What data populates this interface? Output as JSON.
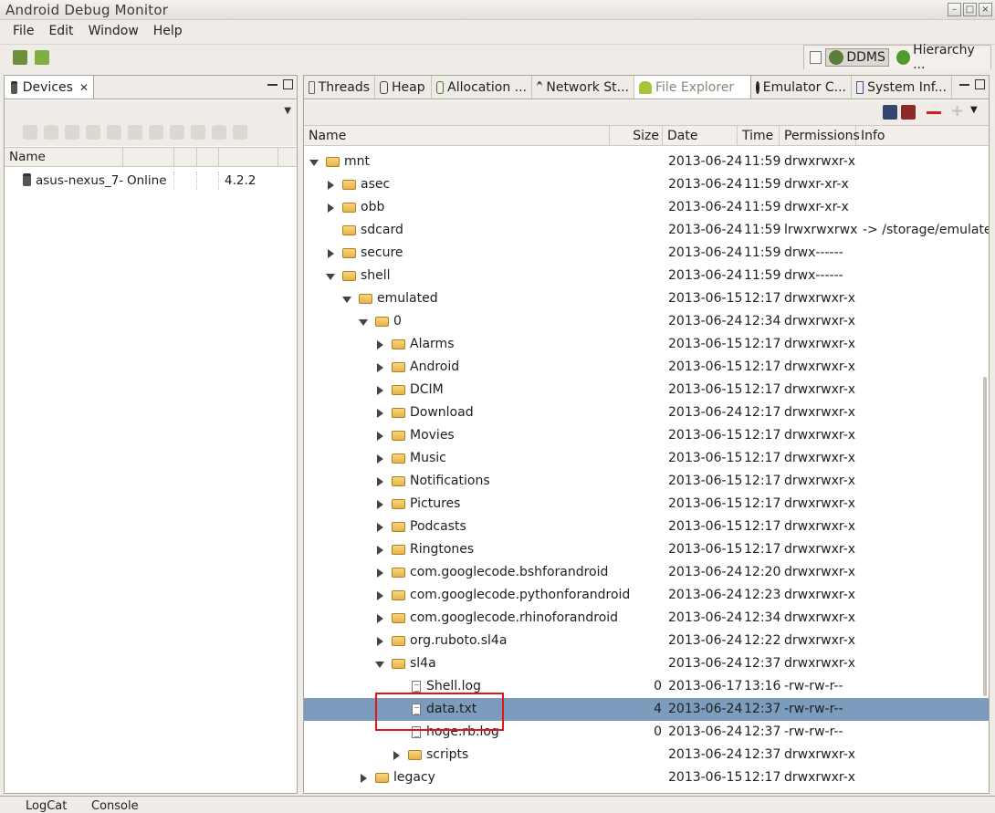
{
  "window": {
    "title": "Android Debug Monitor"
  },
  "menu": [
    "File",
    "Edit",
    "Window",
    "Help"
  ],
  "perspectives": [
    {
      "label": "DDMS",
      "active": true
    },
    {
      "label": "Hierarchy ...",
      "active": false
    }
  ],
  "devices_panel": {
    "tab_label": "Devices",
    "columns": [
      "Name",
      "",
      "",
      "",
      ""
    ],
    "rows": [
      {
        "name": "asus-nexus_7-",
        "status": "Online",
        "c3": "",
        "c4": "",
        "version": "4.2.2"
      }
    ]
  },
  "explorer_panel": {
    "tabs": [
      {
        "label": "Threads"
      },
      {
        "label": "Heap"
      },
      {
        "label": "Allocation ..."
      },
      {
        "label": "Network St..."
      },
      {
        "label": "File Explorer",
        "active": true
      },
      {
        "label": "Emulator C..."
      },
      {
        "label": "System Inf..."
      }
    ],
    "columns": {
      "name": "Name",
      "size": "Size",
      "date": "Date",
      "time": "Time",
      "permissions": "Permissions",
      "info": "Info"
    },
    "rows": [
      {
        "depth": 0,
        "toggle": "down",
        "kind": "folder",
        "name": "mnt",
        "size": "",
        "date": "2013-06-24",
        "time": "11:59",
        "perm": "drwxrwxr-x",
        "info": ""
      },
      {
        "depth": 1,
        "toggle": "right",
        "kind": "folder",
        "name": "asec",
        "size": "",
        "date": "2013-06-24",
        "time": "11:59",
        "perm": "drwxr-xr-x",
        "info": ""
      },
      {
        "depth": 1,
        "toggle": "right",
        "kind": "folder",
        "name": "obb",
        "size": "",
        "date": "2013-06-24",
        "time": "11:59",
        "perm": "drwxr-xr-x",
        "info": ""
      },
      {
        "depth": 1,
        "toggle": "none",
        "kind": "folder",
        "name": "sdcard",
        "size": "",
        "date": "2013-06-24",
        "time": "11:59",
        "perm": "lrwxrwxrwx",
        "info": "-> /storage/emulated/"
      },
      {
        "depth": 1,
        "toggle": "right",
        "kind": "folder",
        "name": "secure",
        "size": "",
        "date": "2013-06-24",
        "time": "11:59",
        "perm": "drwx------",
        "info": ""
      },
      {
        "depth": 1,
        "toggle": "down",
        "kind": "folder",
        "name": "shell",
        "size": "",
        "date": "2013-06-24",
        "time": "11:59",
        "perm": "drwx------",
        "info": ""
      },
      {
        "depth": 2,
        "toggle": "down",
        "kind": "folder",
        "name": "emulated",
        "size": "",
        "date": "2013-06-15",
        "time": "12:17",
        "perm": "drwxrwxr-x",
        "info": ""
      },
      {
        "depth": 3,
        "toggle": "down",
        "kind": "folder",
        "name": "0",
        "size": "",
        "date": "2013-06-24",
        "time": "12:34",
        "perm": "drwxrwxr-x",
        "info": ""
      },
      {
        "depth": 4,
        "toggle": "right",
        "kind": "folder",
        "name": "Alarms",
        "size": "",
        "date": "2013-06-15",
        "time": "12:17",
        "perm": "drwxrwxr-x",
        "info": ""
      },
      {
        "depth": 4,
        "toggle": "right",
        "kind": "folder",
        "name": "Android",
        "size": "",
        "date": "2013-06-15",
        "time": "12:17",
        "perm": "drwxrwxr-x",
        "info": ""
      },
      {
        "depth": 4,
        "toggle": "right",
        "kind": "folder",
        "name": "DCIM",
        "size": "",
        "date": "2013-06-15",
        "time": "12:17",
        "perm": "drwxrwxr-x",
        "info": ""
      },
      {
        "depth": 4,
        "toggle": "right",
        "kind": "folder",
        "name": "Download",
        "size": "",
        "date": "2013-06-24",
        "time": "12:17",
        "perm": "drwxrwxr-x",
        "info": ""
      },
      {
        "depth": 4,
        "toggle": "right",
        "kind": "folder",
        "name": "Movies",
        "size": "",
        "date": "2013-06-15",
        "time": "12:17",
        "perm": "drwxrwxr-x",
        "info": ""
      },
      {
        "depth": 4,
        "toggle": "right",
        "kind": "folder",
        "name": "Music",
        "size": "",
        "date": "2013-06-15",
        "time": "12:17",
        "perm": "drwxrwxr-x",
        "info": ""
      },
      {
        "depth": 4,
        "toggle": "right",
        "kind": "folder",
        "name": "Notifications",
        "size": "",
        "date": "2013-06-15",
        "time": "12:17",
        "perm": "drwxrwxr-x",
        "info": ""
      },
      {
        "depth": 4,
        "toggle": "right",
        "kind": "folder",
        "name": "Pictures",
        "size": "",
        "date": "2013-06-15",
        "time": "12:17",
        "perm": "drwxrwxr-x",
        "info": ""
      },
      {
        "depth": 4,
        "toggle": "right",
        "kind": "folder",
        "name": "Podcasts",
        "size": "",
        "date": "2013-06-15",
        "time": "12:17",
        "perm": "drwxrwxr-x",
        "info": ""
      },
      {
        "depth": 4,
        "toggle": "right",
        "kind": "folder",
        "name": "Ringtones",
        "size": "",
        "date": "2013-06-15",
        "time": "12:17",
        "perm": "drwxrwxr-x",
        "info": ""
      },
      {
        "depth": 4,
        "toggle": "right",
        "kind": "folder",
        "name": "com.googlecode.bshforandroid",
        "size": "",
        "date": "2013-06-24",
        "time": "12:20",
        "perm": "drwxrwxr-x",
        "info": ""
      },
      {
        "depth": 4,
        "toggle": "right",
        "kind": "folder",
        "name": "com.googlecode.pythonforandroid",
        "size": "",
        "date": "2013-06-24",
        "time": "12:23",
        "perm": "drwxrwxr-x",
        "info": ""
      },
      {
        "depth": 4,
        "toggle": "right",
        "kind": "folder",
        "name": "com.googlecode.rhinoforandroid",
        "size": "",
        "date": "2013-06-24",
        "time": "12:34",
        "perm": "drwxrwxr-x",
        "info": ""
      },
      {
        "depth": 4,
        "toggle": "right",
        "kind": "folder",
        "name": "org.ruboto.sl4a",
        "size": "",
        "date": "2013-06-24",
        "time": "12:22",
        "perm": "drwxrwxr-x",
        "info": ""
      },
      {
        "depth": 4,
        "toggle": "down",
        "kind": "folder",
        "name": "sl4a",
        "size": "",
        "date": "2013-06-24",
        "time": "12:37",
        "perm": "drwxrwxr-x",
        "info": ""
      },
      {
        "depth": 5,
        "toggle": "none",
        "kind": "file",
        "name": "Shell.log",
        "size": "0",
        "date": "2013-06-17",
        "time": "13:16",
        "perm": "-rw-rw-r--",
        "info": ""
      },
      {
        "depth": 5,
        "toggle": "none",
        "kind": "file",
        "name": "data.txt",
        "size": "4",
        "date": "2013-06-24",
        "time": "12:37",
        "perm": "-rw-rw-r--",
        "info": "",
        "selected": true
      },
      {
        "depth": 5,
        "toggle": "none",
        "kind": "file",
        "name": "hoge.rb.log",
        "size": "0",
        "date": "2013-06-24",
        "time": "12:37",
        "perm": "-rw-rw-r--",
        "info": ""
      },
      {
        "depth": 5,
        "toggle": "right",
        "kind": "folder",
        "name": "scripts",
        "size": "",
        "date": "2013-06-24",
        "time": "12:37",
        "perm": "drwxrwxr-x",
        "info": ""
      },
      {
        "depth": 3,
        "toggle": "right",
        "kind": "folder",
        "name": "legacy",
        "size": "",
        "date": "2013-06-15",
        "time": "12:17",
        "perm": "drwxrwxr-x",
        "info": ""
      }
    ]
  },
  "bottom_tabs": [
    "LogCat",
    "Console"
  ]
}
